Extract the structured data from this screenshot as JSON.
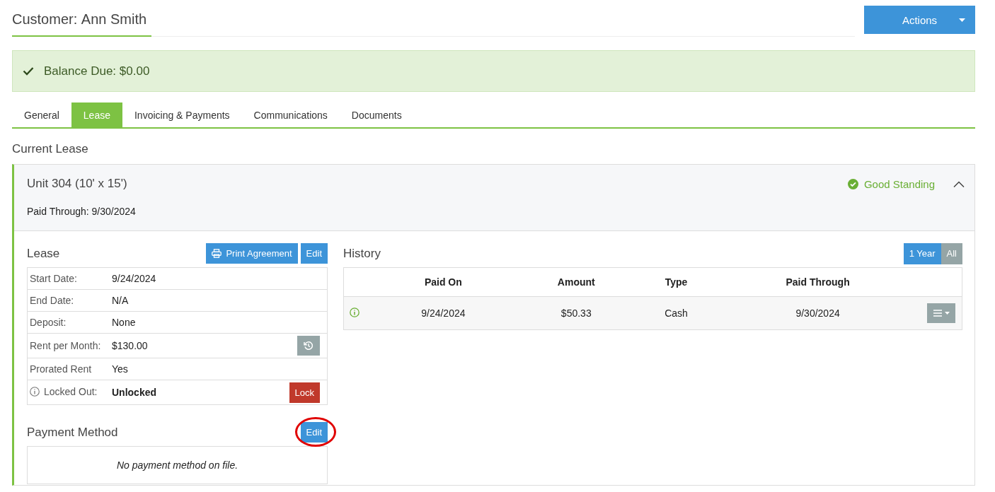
{
  "customer": {
    "label": "Customer:",
    "name": "Ann Smith"
  },
  "actions_button": {
    "label": "Actions"
  },
  "balance": {
    "label": "Balance Due:",
    "amount": "$0.00"
  },
  "tabs": [
    {
      "label": "General",
      "selected": false
    },
    {
      "label": "Lease",
      "selected": true
    },
    {
      "label": "Invoicing & Payments",
      "selected": false
    },
    {
      "label": "Communications",
      "selected": false
    },
    {
      "label": "Documents",
      "selected": false
    }
  ],
  "section_title": "Current Lease",
  "unit": {
    "title": "Unit 304 (10' x 15')",
    "status": "Good Standing",
    "expanded": true,
    "paid_through_label": "Paid Through:",
    "paid_through": "9/30/2024"
  },
  "lease": {
    "title": "Lease",
    "print_button": "Print Agreement",
    "edit_button": "Edit",
    "rows": [
      {
        "kind": "plain",
        "label": "Start Date:",
        "value": "9/24/2024"
      },
      {
        "kind": "plain",
        "label": "End Date:",
        "value": "N/A"
      },
      {
        "kind": "plain",
        "label": "Deposit:",
        "value": "None"
      },
      {
        "kind": "history",
        "label": "Rent per Month:",
        "value": "$130.00"
      },
      {
        "kind": "plain",
        "label": "Prorated Rent",
        "value": "Yes"
      },
      {
        "kind": "lock",
        "label": "Locked Out:",
        "value": "Unlocked",
        "action": "Lock"
      }
    ]
  },
  "payment_method": {
    "title": "Payment Method",
    "edit_button": "Edit",
    "highlighted": true,
    "empty_text": "No payment method on file."
  },
  "history": {
    "title": "History",
    "ranges": [
      {
        "label": "1 Year",
        "selected": true
      },
      {
        "label": "All",
        "selected": false
      }
    ],
    "columns": [
      "Paid On",
      "Amount",
      "Type",
      "Paid Through"
    ],
    "rows": [
      {
        "cells": [
          "9/24/2024",
          "$50.33",
          "Cash",
          "9/30/2024"
        ]
      }
    ]
  }
}
